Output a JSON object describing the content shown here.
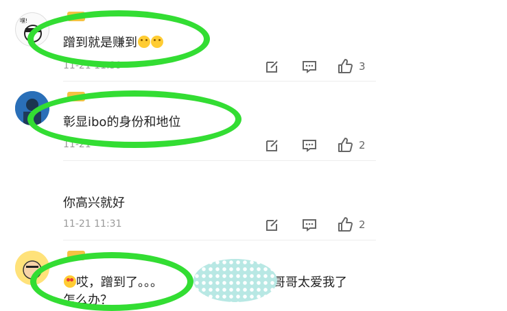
{
  "comments": [
    {
      "username": "",
      "text": "蹭到就是赚到",
      "time": "11-21 11:39",
      "like_count": "3"
    },
    {
      "username": "",
      "text": "彰显ibo的身份和地位",
      "time": "11-21",
      "like_count": "2"
    },
    {
      "text": "你高兴就好",
      "time": "11-21 11:31",
      "like_count": "2"
    },
    {
      "username": "",
      "text_line1_a": "哎，蹭到了。。。",
      "text_line1_b": "哥哥太爱我了",
      "text_line2": "怎么办？"
    }
  ],
  "icons": {
    "reply": "reply-edit-icon",
    "comment": "comment-bubble-icon",
    "like": "thumbs-up-icon"
  },
  "colors": {
    "highlight": "#33dd33",
    "vip_badge": "#f5c242"
  }
}
